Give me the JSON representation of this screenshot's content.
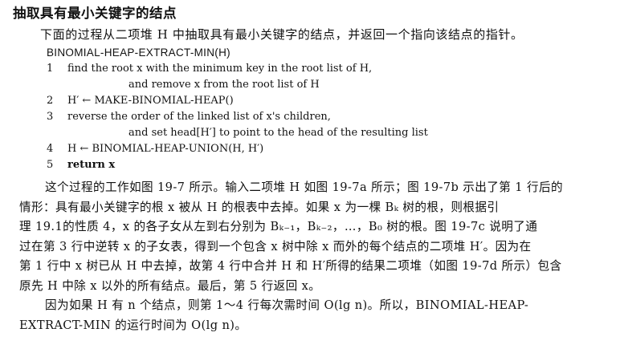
{
  "heading": "抽取具有最小关键字的结点",
  "intro": "下面的过程从二项堆 H 中抽取具有最小关键字的结点，并返回一个指向该结点的指针。",
  "code": {
    "title": "BINOMIAL-HEAP-EXTRACT-MIN(H)",
    "lines": [
      {
        "num": "1",
        "text": "find the root x with the minimum key in the root list of H,"
      },
      {
        "num": "",
        "text": "and remove x from the root list of H"
      },
      {
        "num": "2",
        "text": "H′ ← MAKE-BINOMIAL-HEAP()"
      },
      {
        "num": "3",
        "text": "reverse the order of the linked list of x's children,"
      },
      {
        "num": "",
        "text": "and set head[H′] to point to the head of the resulting list"
      },
      {
        "num": "4",
        "text": "H ← BINOMIAL-HEAP-UNION(H, H′)"
      },
      {
        "num": "5",
        "text": "return x"
      }
    ]
  },
  "paragraph1": [
    "这个过程的工作如图 19-7 所示。输入二项堆 H 如图 19-7a 所示；图 19-7b 示出了第 1 行后的",
    "情形：具有最小关键字的根 x 被从 H 的根表中去掉。如果 x 为一棵 Bₖ 树的根，则根据引",
    "理 19.1的性质 4，x 的各子女从左到右分别为 Bₖ₋₁，Bₖ₋₂，…，B₀ 树的根。图 19-7c 说明了通",
    "过在第 3 行中逆转 x 的子女表，得到一个包含 x 树中除 x 而外的每个结点的二项堆 H′。因为在",
    "第 1 行中 x 树已从 H 中去掉，故第 4 行中合并 H 和 H′所得的结果二项堆（如图 19-7d 所示）包含",
    "原先 H 中除 x 以外的所有结点。最后，第 5 行返回 x。"
  ],
  "paragraph2": [
    "因为如果 H 有 n 个结点，则第 1～4 行每次需时间 O(lg n)。所以，BINOMIAL-HEAP-",
    "EXTRACT-MIN 的运行时间为 O(lg n)。"
  ]
}
